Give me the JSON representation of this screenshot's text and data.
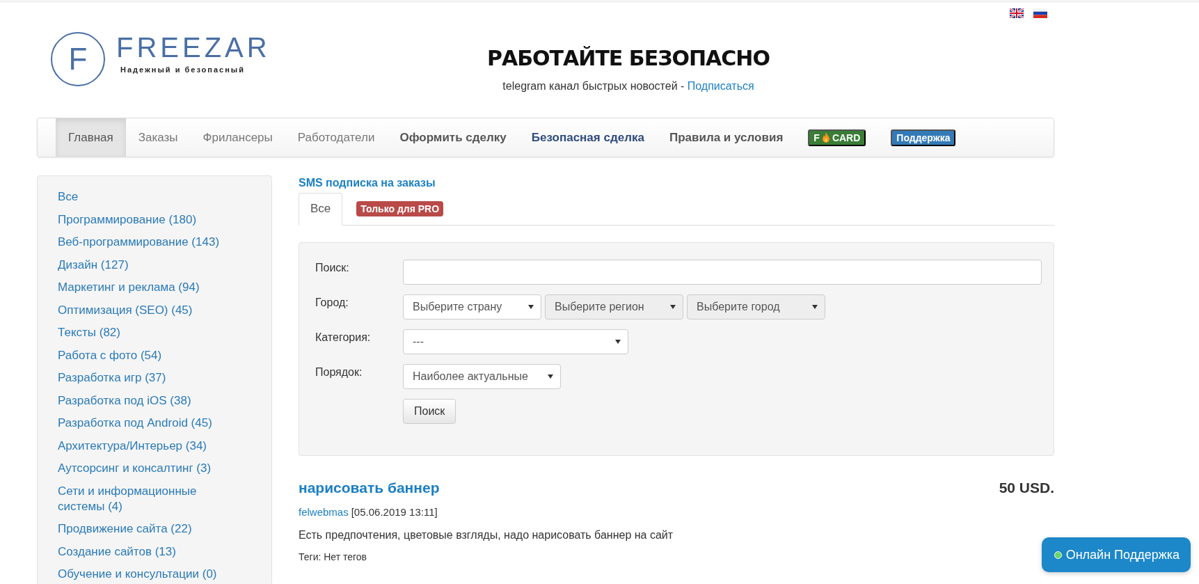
{
  "header": {
    "logo_letter": "F",
    "logo_name": "FREEZAR",
    "logo_tagline": "Надежный и безопасный",
    "headline": "РАБОТАЙТЕ БЕЗОПАСНО",
    "telegram_text": "telegram канал быстрых новостей -",
    "telegram_link": "Подписаться"
  },
  "nav": [
    {
      "kind": "link",
      "label": "Главная",
      "selected": true
    },
    {
      "kind": "link",
      "label": "Заказы",
      "selected": false
    },
    {
      "kind": "link",
      "label": "Фрилансеры",
      "selected": false
    },
    {
      "kind": "link",
      "label": "Работодатели",
      "selected": false
    },
    {
      "kind": "strong",
      "label": "Оформить сделку",
      "selected": false
    },
    {
      "kind": "accent",
      "label": "Безопасная сделка",
      "selected": false
    },
    {
      "kind": "strong",
      "label": "Правила и условия",
      "selected": false
    },
    {
      "kind": "card",
      "prefix": "F",
      "label": "CARD",
      "color": "#3a7d36",
      "selected": false
    },
    {
      "kind": "badge",
      "label": "Поддержка",
      "color": "#337ab7",
      "selected": false
    }
  ],
  "sidebar": {
    "items": [
      "Все",
      "Программирование (180)",
      "Веб-программирование (143)",
      "Дизайн (127)",
      "Маркетинг и реклама (94)",
      "Оптимизация (SEO) (45)",
      "Тексты (82)",
      "Работа с фото (54)",
      "Разработка игр (37)",
      "Разработка под iOS (38)",
      "Разработка под Android (45)",
      "Архитектура/Интерьер (34)",
      "Аутсорсинг и консалтинг (3)",
      "Сети и информационные системы (4)",
      "Продвижение сайта (22)",
      "Создание сайтов (13)",
      "Обучение и консультации (0)"
    ]
  },
  "sms_link": "SMS подписка на заказы",
  "tabs": [
    {
      "kind": "tab",
      "label": "Все",
      "selected": true
    },
    {
      "kind": "badge",
      "label": "Только для PRO",
      "color": "#b94a48",
      "selected": false
    }
  ],
  "filter": {
    "rows": [
      {
        "label": "Поиск:",
        "kind": "text",
        "value": ""
      },
      {
        "label": "Город:",
        "kind": "selects",
        "selects": [
          {
            "value": "Выберите страну",
            "disabled": false
          },
          {
            "value": "Выберите регион",
            "disabled": true
          },
          {
            "value": "Выберите город",
            "disabled": true
          }
        ]
      },
      {
        "label": "Категория:",
        "kind": "select",
        "value": "---",
        "wide": true
      },
      {
        "label": "Порядок:",
        "kind": "select",
        "value": "Наиболее актуальные",
        "wide": false
      }
    ],
    "button": "Поиск"
  },
  "orders": [
    {
      "title": "нарисовать баннер",
      "price": "50 USD.",
      "author": "felwebmas",
      "date": "[05.06.2019 13:11]",
      "description": "Есть предпочтения, цветовые взгляды, надо нарисовать баннер на сайт",
      "tags": "Теги: Нет тегов"
    }
  ],
  "support_button": "Онлайн Поддержка"
}
